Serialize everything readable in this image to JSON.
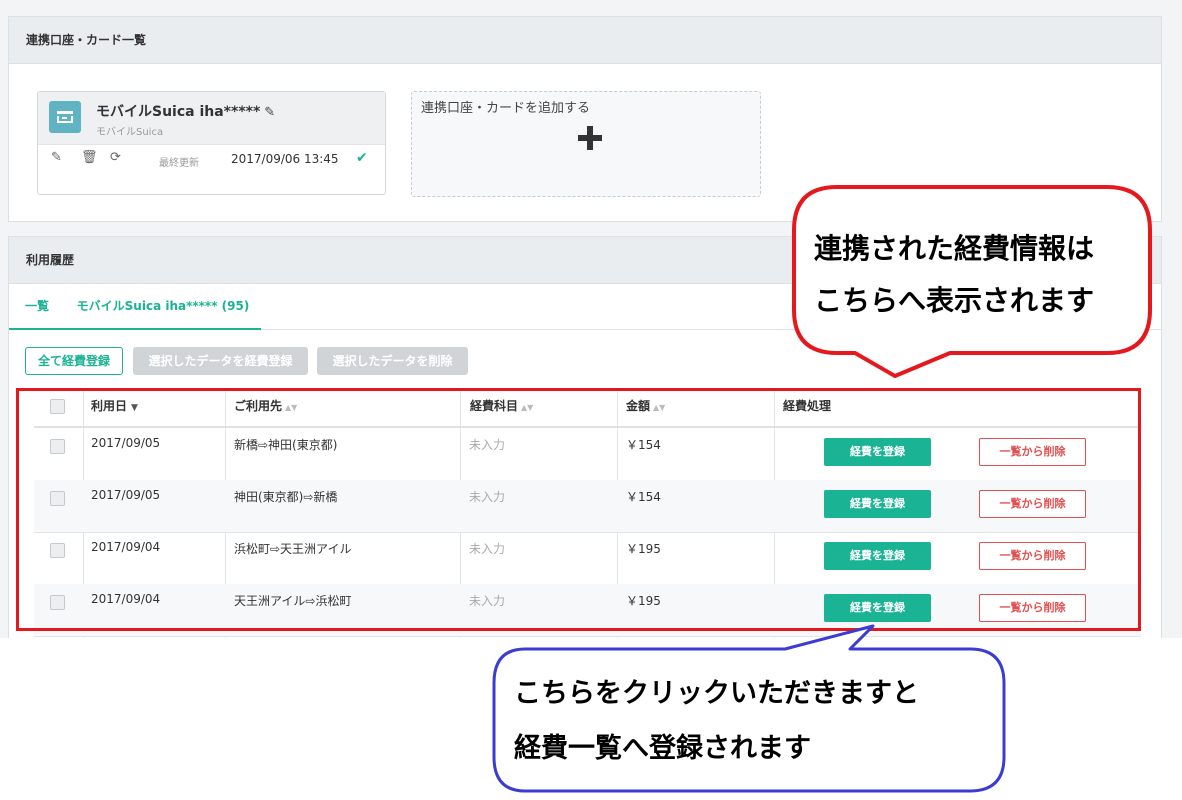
{
  "accounts_panel": {
    "title": "連携口座・カード一覧",
    "card": {
      "name": "モバイルSuica iha*****",
      "type": "モバイルSuica",
      "last_updated_label": "最終更新",
      "last_updated": "2017/09/06 13:45"
    },
    "add_card_label": "連携口座・カードを追加する"
  },
  "history_panel": {
    "title": "利用履歴",
    "tabs": [
      {
        "label": "一覧"
      },
      {
        "label": "モバイルSuica iha***** (95)"
      }
    ],
    "buttons": {
      "register_all": "全て経費登録",
      "register_selected": "選択したデータを経費登録",
      "delete_selected": "選択したデータを削除"
    },
    "columns": [
      "利用日",
      "ご利用先",
      "経費科目",
      "金額",
      "経費処理"
    ],
    "rows": [
      {
        "date": "2017/09/05",
        "dest": "新橋⇨神田(東京都)",
        "category": "未入力",
        "amount": "￥154"
      },
      {
        "date": "2017/09/05",
        "dest": "神田(東京都)⇨新橋",
        "category": "未入力",
        "amount": "￥154"
      },
      {
        "date": "2017/09/04",
        "dest": "浜松町⇨天王洲アイル",
        "category": "未入力",
        "amount": "￥195"
      },
      {
        "date": "2017/09/04",
        "dest": "天王洲アイル⇨浜松町",
        "category": "未入力",
        "amount": "￥195"
      }
    ],
    "row_register_label": "経費を登録",
    "row_remove_label": "一覧から削除"
  },
  "annotations": {
    "top": {
      "line1": "連携された経費情報は",
      "line2": "こちらへ表示されます"
    },
    "bottom": {
      "line1": "こちらをクリックいただきますと",
      "line2": "経費一覧へ登録されます"
    }
  },
  "colors": {
    "accent": "#1ab394",
    "danger": "#e05050",
    "annotation_red": "#e5191d",
    "annotation_blue": "#3c3cd2"
  }
}
